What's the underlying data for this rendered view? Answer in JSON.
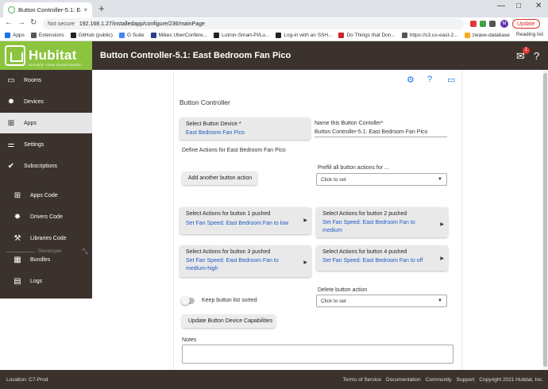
{
  "browser": {
    "tab_title": "Button Controller-5.1: East Bedr",
    "tab_close": "×",
    "new_tab": "+",
    "not_secure": "Not secure",
    "url": "192.168.1.27/installedapp/configure/236/mainPage",
    "update_label": "Update",
    "profile_initial": "M",
    "window_controls": [
      "—",
      "□",
      "✕"
    ],
    "bookmarks": [
      {
        "label": "Apps",
        "icon": "apps-grid-icon"
      },
      {
        "label": "Extensions",
        "icon": "puzzle-icon"
      },
      {
        "label": "GitHub (public)",
        "icon": "github-icon"
      },
      {
        "label": "G Suite",
        "icon": "google-icon"
      },
      {
        "label": "Mikes UberConfere...",
        "icon": "uberconference-icon"
      },
      {
        "label": "Lutron-Smart-Pi/Lu...",
        "icon": "github-icon"
      },
      {
        "label": "Log-in with an SSH...",
        "icon": "github-icon"
      },
      {
        "label": "Do Things that Don...",
        "icon": "flag-icon"
      },
      {
        "label": "https://s3.us-east-2...",
        "icon": "globe-icon"
      },
      {
        "label": "zwave-database",
        "icon": "folder-icon"
      }
    ],
    "reading_list": "Reading list"
  },
  "header": {
    "brand": "Hubitat",
    "tagline": "ELEVATE YOUR ENVIRONMENT",
    "title": "Button Controller-5.1: East Bedroom Fan Pico",
    "notification_count": "1"
  },
  "sidebar": {
    "items": [
      {
        "label": "Rooms",
        "icon": "rooms-icon"
      },
      {
        "label": "Devices",
        "icon": "devices-icon"
      },
      {
        "label": "Apps",
        "icon": "apps-icon"
      },
      {
        "label": "Settings",
        "icon": "settings-icon"
      },
      {
        "label": "Subscriptions",
        "icon": "subscriptions-icon"
      }
    ],
    "developer_label": "Developer",
    "dev_items": [
      {
        "label": "Apps Code",
        "icon": "apps-code-icon"
      },
      {
        "label": "Drivers Code",
        "icon": "drivers-code-icon"
      },
      {
        "label": "Libraries Code",
        "icon": "libraries-code-icon"
      },
      {
        "label": "Bundles",
        "icon": "bundles-icon"
      },
      {
        "label": "Logs",
        "icon": "logs-icon"
      }
    ],
    "active": "Apps"
  },
  "main": {
    "section_title": "Button Controller",
    "select_device": {
      "label": "Select Button Device *",
      "value": "East Bedroom Fan Pico"
    },
    "name_label": "Name this Button Contoller*",
    "name_value": "Button Controller-5.1: East Bedroom Fan Pico",
    "define_actions": "Define Actions for East Bedroom Fan Pico",
    "prefill_label": "Prefill all button actions for ...",
    "prefill_value": "Click to set",
    "add_button": "Add another button action",
    "buttons": [
      {
        "label": "Select Actions for button 1 pushed",
        "value": "Set Fan Speed: East Bedroom Fan to low"
      },
      {
        "label": "Select Actions for button 2 pushed",
        "value": "Set Fan Speed: East Bedroom Fan to medium"
      },
      {
        "label": "Select Actions for button 3 pushed",
        "value": "Set Fan Speed: East Bedroom Fan to medium-high"
      },
      {
        "label": "Select Actions for button 4 pushed",
        "value": "Set Fan Speed: East Bedroom Fan to off"
      }
    ],
    "delete_label": "Delete button action",
    "delete_value": "Click to set",
    "keep_sorted": "Keep button list sorted",
    "keep_sorted_on": false,
    "update_caps": "Update Button Device Capabilities",
    "notes_label": "Notes",
    "notes_value": ""
  },
  "footer": {
    "location": "Location: C7-Prod",
    "links": [
      "Terms of Service",
      "Documentation",
      "Community",
      "Support",
      "Copyright 2021 Hubitat, Inc."
    ]
  },
  "colors": {
    "brand_green": "#8cc43f",
    "header_bg": "#3b322e",
    "link_blue": "#1e5bc6",
    "accent_blue": "#1a73e8"
  }
}
